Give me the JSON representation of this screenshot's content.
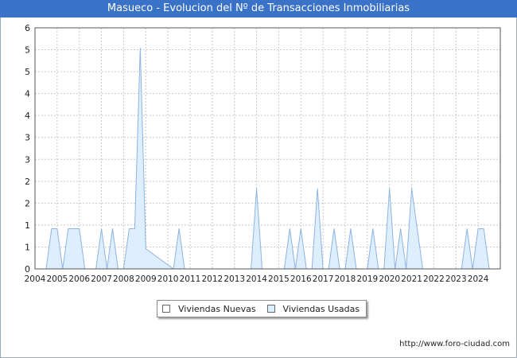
{
  "title": "Masueco - Evolucion del Nº de Transacciones Inmobiliarias",
  "source": "http://www.foro-ciudad.com",
  "colors": {
    "title_bar": "#3a72c8",
    "nuevas_fill": "#ffffff",
    "usadas_fill": "#ddeeff",
    "usadas_stroke": "#8fb4df",
    "grid": "#c8c8c8"
  },
  "chart_data": {
    "type": "area",
    "title": "Masueco - Evolucion del Nº de Transacciones Inmobiliarias",
    "xlabel": "",
    "ylabel": "",
    "xlim": [
      2004,
      2025
    ],
    "ylim": [
      0,
      6
    ],
    "x_ticks": [
      "2004",
      "2005",
      "2006",
      "2007",
      "2008",
      "2009",
      "2010",
      "2011",
      "2012",
      "2013",
      "2014",
      "2015",
      "2016",
      "2017",
      "2018",
      "2019",
      "2020",
      "2021",
      "2022",
      "2023",
      "2024"
    ],
    "y_ticks": [
      "0",
      "1",
      "1",
      "2",
      "2",
      "3",
      "3",
      "4",
      "4",
      "5",
      "5",
      "6"
    ],
    "grid": true,
    "legend": "bottom",
    "series": [
      {
        "name": "Viviendas Nuevas",
        "points": []
      },
      {
        "name": "Viviendas Usadas",
        "points": [
          [
            2004.5,
            0
          ],
          [
            2004.75,
            1
          ],
          [
            2005.0,
            1
          ],
          [
            2005.25,
            0
          ],
          [
            2005.5,
            1
          ],
          [
            2006.0,
            1
          ],
          [
            2006.25,
            0
          ],
          [
            2006.75,
            0
          ],
          [
            2007.0,
            1
          ],
          [
            2007.25,
            0
          ],
          [
            2007.25,
            0
          ],
          [
            2007.5,
            1
          ],
          [
            2007.75,
            0
          ],
          [
            2008.0,
            0
          ],
          [
            2008.25,
            1
          ],
          [
            2008.5,
            1
          ],
          [
            2008.75,
            5.5
          ],
          [
            2009.0,
            0.5
          ],
          [
            2010.25,
            0
          ],
          [
            2010.5,
            1
          ],
          [
            2010.75,
            0
          ],
          [
            2013.75,
            0
          ],
          [
            2014.0,
            2
          ],
          [
            2014.25,
            0
          ],
          [
            2015.25,
            0
          ],
          [
            2015.5,
            1
          ],
          [
            2015.75,
            0
          ],
          [
            2015.75,
            0
          ],
          [
            2016.0,
            1
          ],
          [
            2016.25,
            0
          ],
          [
            2016.5,
            0
          ],
          [
            2016.75,
            2
          ],
          [
            2017.0,
            0
          ],
          [
            2017.25,
            0
          ],
          [
            2017.5,
            1
          ],
          [
            2017.75,
            0
          ],
          [
            2018.0,
            0
          ],
          [
            2018.25,
            1
          ],
          [
            2018.5,
            0
          ],
          [
            2019.0,
            0
          ],
          [
            2019.25,
            1
          ],
          [
            2019.5,
            0
          ],
          [
            2019.75,
            0
          ],
          [
            2020.0,
            2
          ],
          [
            2020.25,
            0
          ],
          [
            2020.25,
            0
          ],
          [
            2020.5,
            1
          ],
          [
            2020.75,
            0
          ],
          [
            2020.75,
            0
          ],
          [
            2021.0,
            2
          ],
          [
            2021.5,
            0
          ],
          [
            2023.25,
            0
          ],
          [
            2023.5,
            1
          ],
          [
            2023.75,
            0
          ],
          [
            2023.75,
            0
          ],
          [
            2024.0,
            1
          ],
          [
            2024.25,
            1
          ],
          [
            2024.5,
            0
          ]
        ]
      }
    ]
  }
}
